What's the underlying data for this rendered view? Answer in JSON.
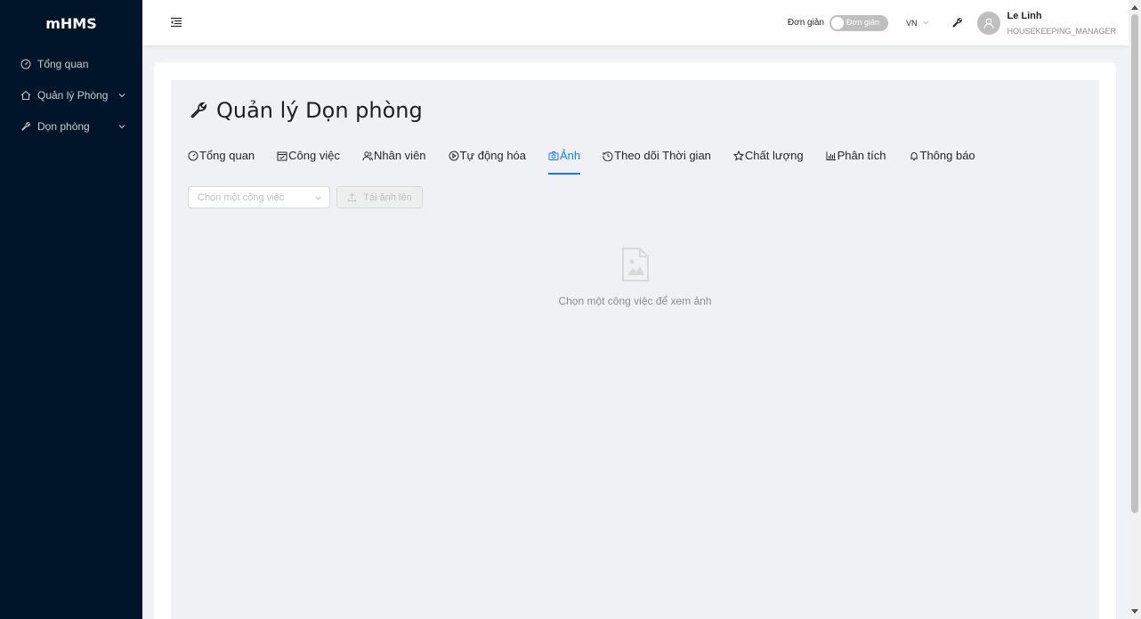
{
  "app": {
    "logo": "mHMS"
  },
  "sidebar": {
    "items": [
      {
        "label": "Tổng quan",
        "icon": "dashboard-icon",
        "has_submenu": false
      },
      {
        "label": "Quản lý Phòng",
        "icon": "home-icon",
        "has_submenu": true
      },
      {
        "label": "Dọn phòng",
        "icon": "wrench-icon",
        "has_submenu": true
      }
    ]
  },
  "header": {
    "simple_mode_label": "Đơn giản",
    "simple_mode_switch_text": "Đơn giản",
    "simple_mode_on": false,
    "language": "VN",
    "user": {
      "name": "Le Linh",
      "role": "HOUSEKEEPING_MANAGER"
    }
  },
  "page": {
    "title": "Quản lý Dọn phòng",
    "tabs": [
      {
        "label": "Tổng quan",
        "icon": "dashboard-icon"
      },
      {
        "label": "Công việc",
        "icon": "calendar-check-icon"
      },
      {
        "label": "Nhân viên",
        "icon": "users-icon"
      },
      {
        "label": "Tự động hóa",
        "icon": "play-circle-icon"
      },
      {
        "label": "Ảnh",
        "icon": "camera-icon"
      },
      {
        "label": "Theo dõi Thời gian",
        "icon": "history-icon"
      },
      {
        "label": "Chất lượng",
        "icon": "star-icon"
      },
      {
        "label": "Phân tích",
        "icon": "bar-chart-icon"
      },
      {
        "label": "Thông báo",
        "icon": "bell-icon"
      }
    ],
    "active_tab": "Ảnh",
    "task_select": {
      "placeholder": "Chọn một công việc"
    },
    "upload_button": {
      "label": "Tải ảnh lên",
      "disabled": true
    },
    "empty_state": {
      "message": "Chọn một công việc để xem ảnh"
    }
  },
  "colors": {
    "sidebar_bg": "#001529",
    "accent": "#1677ff",
    "content_bg": "#f0f1f4"
  }
}
